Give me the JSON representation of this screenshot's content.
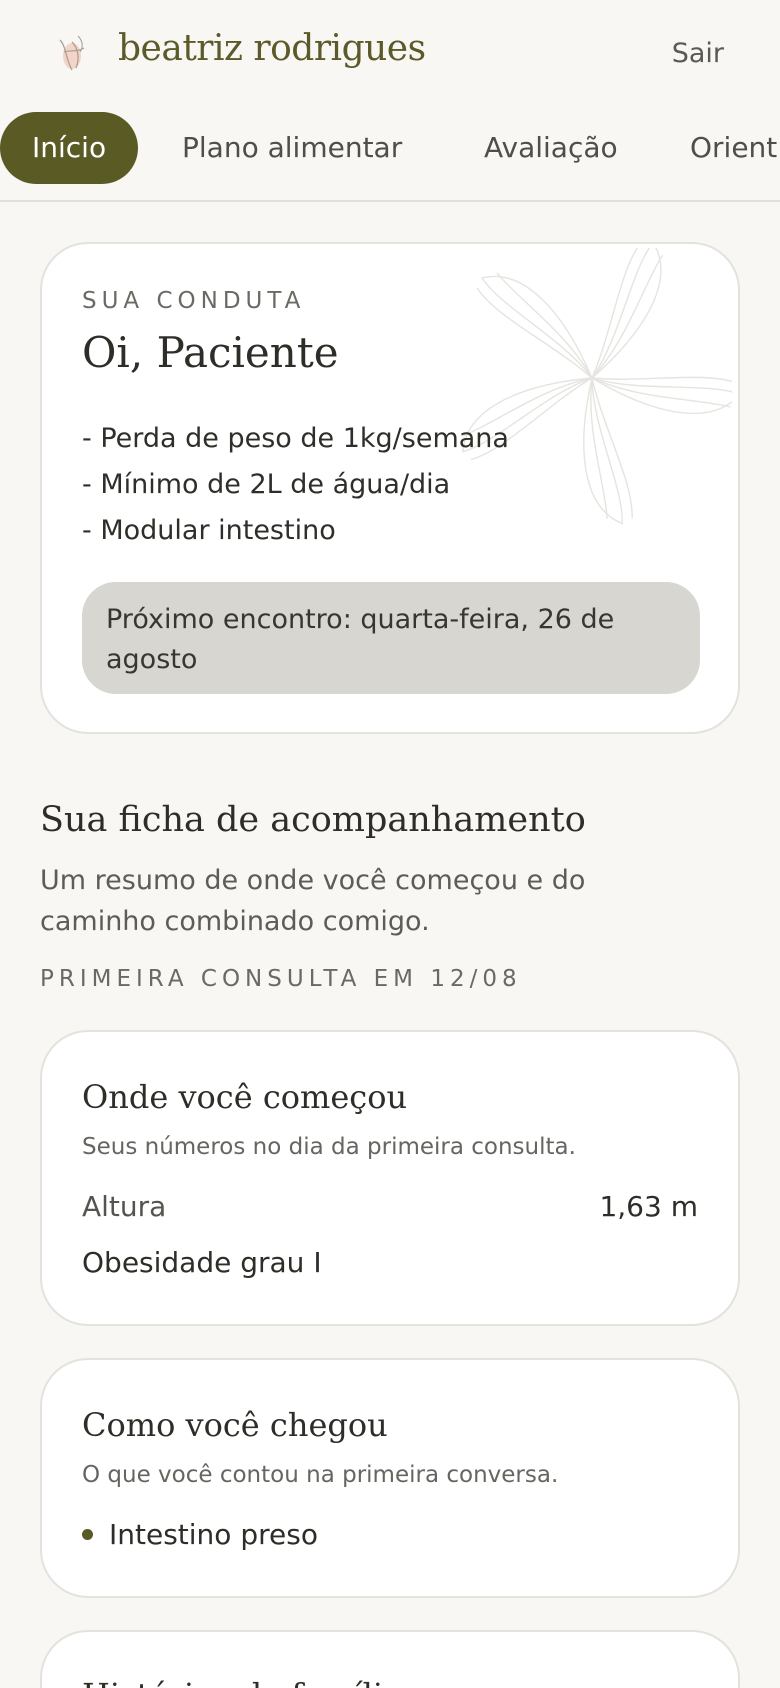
{
  "header": {
    "brand": "beatriz rodrigues",
    "logout_label": "Sair"
  },
  "tabs": [
    {
      "label": "Início",
      "active": true
    },
    {
      "label": "Plano alimentar",
      "active": false
    },
    {
      "label": "Avaliação",
      "active": false
    },
    {
      "label": "Orient",
      "active": false
    }
  ],
  "conduta": {
    "eyebrow": "SUA CONDUTA",
    "greeting": "Oi, Paciente",
    "lines": [
      "- Perda de peso de 1kg/semana",
      "- Mínimo de 2L de água/dia",
      "- Modular intestino"
    ],
    "next_meeting": "Próximo encontro: quarta-feira, 26 de agosto"
  },
  "ficha": {
    "title": "Sua ficha de acompanhamento",
    "subtitle": "Um resumo de onde você começou e do caminho combinado comigo.",
    "eyebrow": "PRIMEIRA CONSULTA EM 12/08"
  },
  "start_card": {
    "title": "Onde você começou",
    "subtitle": "Seus números no dia da primeira consulta.",
    "height_label": "Altura",
    "height_value": "1,63 m",
    "classification": "Obesidade grau I"
  },
  "arrived_card": {
    "title": "Como você chegou",
    "subtitle": "O que você contou na primeira conversa.",
    "items": [
      "Intestino preso"
    ]
  },
  "history_card": {
    "title": "Histórico de família"
  },
  "colors": {
    "accent": "#5a5a25",
    "background": "#f8f7f4",
    "card": "#ffffff",
    "pill": "#d8d6d1"
  }
}
